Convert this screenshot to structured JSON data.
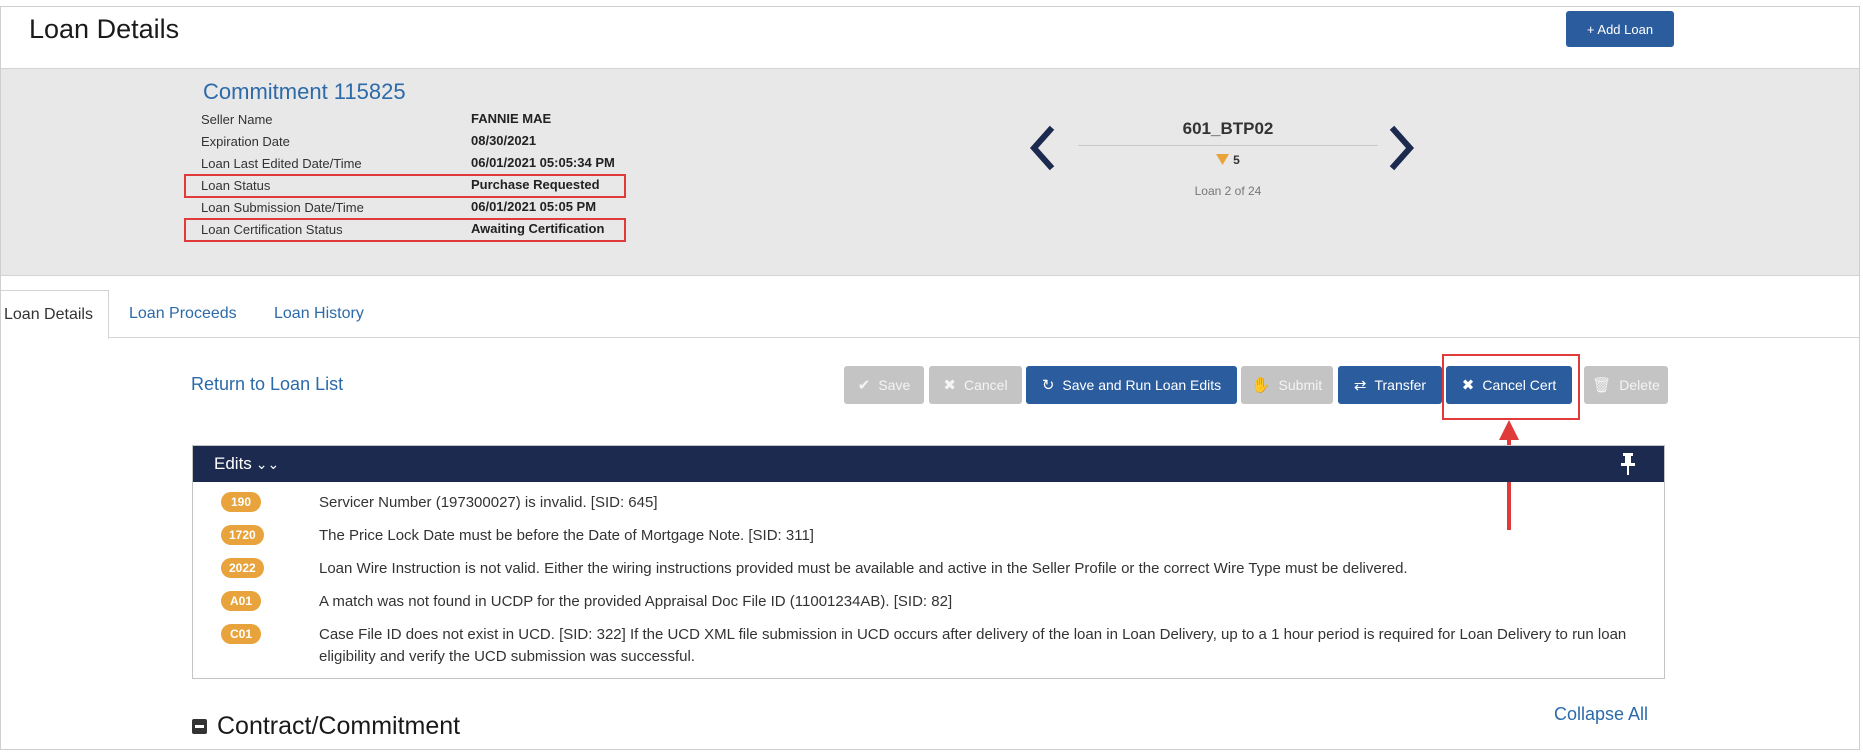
{
  "header": {
    "title": "Loan Details",
    "add_loan_label": "+ Add Loan"
  },
  "commitment": {
    "title": "Commitment 115825",
    "fields": [
      {
        "label": "Seller Name",
        "value": "FANNIE MAE"
      },
      {
        "label": "Expiration Date",
        "value": "08/30/2021"
      },
      {
        "label": "Loan Last Edited Date/Time",
        "value": "06/01/2021 05:05:34 PM"
      },
      {
        "label": "Loan Status",
        "value": "Purchase Requested"
      },
      {
        "label": "Loan Submission Date/Time",
        "value": "06/01/2021 05:05 PM"
      },
      {
        "label": "Loan Certification Status",
        "value": "Awaiting Certification"
      }
    ]
  },
  "loan_nav": {
    "loan_id": "601_BTP02",
    "edit_count": "5",
    "position": "Loan 2 of 24"
  },
  "tabs": [
    {
      "label": "Loan Details"
    },
    {
      "label": "Loan Proceeds"
    },
    {
      "label": "Loan History"
    }
  ],
  "actions": {
    "return_link": "Return to Loan List",
    "save": "Save",
    "cancel": "Cancel",
    "save_run": "Save and Run Loan Edits",
    "submit": "Submit",
    "transfer": "Transfer",
    "cancel_cert": "Cancel Cert",
    "delete": "Delete"
  },
  "edits": {
    "title": "Edits",
    "items": [
      {
        "code": "190",
        "message": "Servicer Number (197300027) is invalid. [SID: 645]"
      },
      {
        "code": "1720",
        "message": "The Price Lock Date must be before the Date of Mortgage Note. [SID: 311]"
      },
      {
        "code": "2022",
        "message": "Loan Wire Instruction is not valid. Either the wiring instructions provided must be available and active in the Seller Profile or the correct Wire Type must be delivered."
      },
      {
        "code": "A01",
        "message": "A match was not found in UCDP for the provided Appraisal Doc File ID (11001234AB). [SID: 82]"
      },
      {
        "code": "C01",
        "message": "Case File ID does not exist in UCD. [SID: 322] If the UCD XML file submission in UCD occurs after delivery of the loan in Loan Delivery, up to a 1 hour period is required for Loan Delivery to run loan eligibility and verify the UCD submission was successful."
      }
    ]
  },
  "sections": {
    "collapse_all": "Collapse All",
    "contract_title": "Contract/Commitment"
  },
  "colors": {
    "primary": "#2a5c9e",
    "link": "#2c6aa9",
    "edits_header": "#1b2a4e",
    "badge": "#e8a33c",
    "highlight": "#e03a3a"
  }
}
